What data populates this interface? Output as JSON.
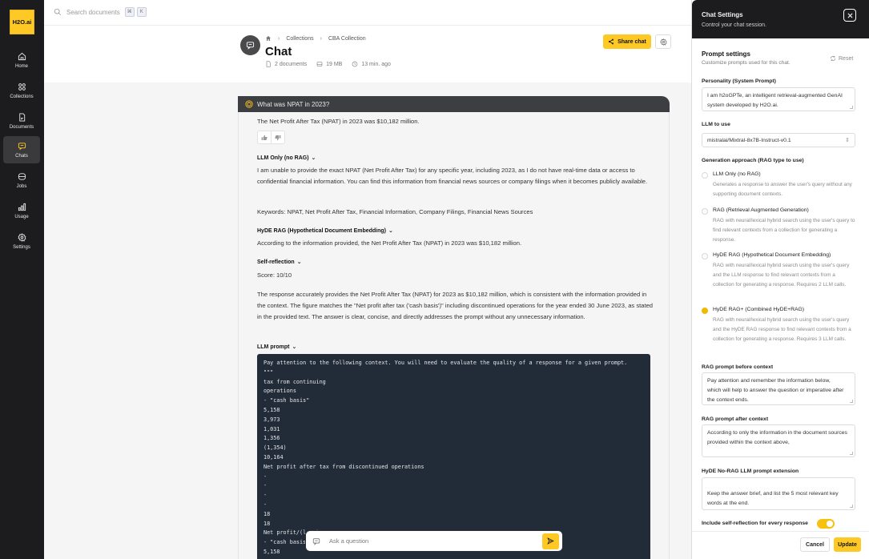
{
  "app": {
    "logo": "H2O.ai"
  },
  "sidebar": {
    "items": [
      {
        "label": "Home",
        "icon": "home-icon"
      },
      {
        "label": "Collections",
        "icon": "collections-icon"
      },
      {
        "label": "Documents",
        "icon": "document-icon"
      },
      {
        "label": "Chats",
        "icon": "chat-icon",
        "active": true
      },
      {
        "label": "Jobs",
        "icon": "jobs-icon"
      },
      {
        "label": "Usage",
        "icon": "usage-icon"
      },
      {
        "label": "Settings",
        "icon": "settings-icon"
      }
    ]
  },
  "search": {
    "placeholder": "Search documents",
    "kbd": [
      "⌘",
      "K"
    ]
  },
  "header": {
    "breadcrumb": [
      "Collections",
      "CBA Collection"
    ],
    "title": "Chat",
    "meta": {
      "documents": "2 documents",
      "size": "19 MB",
      "time": "13 min. ago"
    },
    "share_label": "Share chat"
  },
  "conversation": {
    "question": "What was NPAT in 2023?",
    "answer": "The Net Profit After Tax (NPAT) in 2023 was $10,182 million.",
    "sections": {
      "llm_only": {
        "title": "LLM Only (no RAG)",
        "text": "I am unable to provide the exact NPAT (Net Profit After Tax) for any specific year, including 2023, as I do not have real-time data or access to confidential financial information. You can find this information from financial news sources or company filings when it becomes publicly available.",
        "keywords": "Keywords: NPAT, Net Profit After Tax, Financial Information, Company Filings, Financial News Sources"
      },
      "hyde": {
        "title": "HyDE RAG (Hypothetical Document Embedding)",
        "text": "According to the information provided, the Net Profit After Tax (NPAT) in 2023 was $10,182 million."
      },
      "self_reflection": {
        "title": "Self-reflection",
        "score": "Score: 10/10",
        "text": "The response accurately provides the Net Profit After Tax (NPAT) for 2023 as $10,182 million, which is consistent with the information provided in the context. The figure matches the \"Net profit after tax ('cash basis')\" including discontinued operations for the year ended 30 June 2023, as stated in the provided text. The answer is clear, concise, and directly addresses the prompt without any unnecessary information."
      },
      "llm_prompt": {
        "title": "LLM prompt",
        "lines": [
          "Pay attention to the following context. You will need to evaluate the quality of a response for a given prompt.",
          "\"\"\"",
          "tax from continuing",
          "operations",
          "- \"cash basis\"",
          "5,158",
          "3,973",
          "1,031",
          "1,356",
          "(1,354)",
          "10,164",
          "Net profit after tax from discontinued operations",
          "-",
          "-",
          "-",
          "-",
          "18",
          "18",
          "Net profit/(loss)",
          "- \"cash basis\"",
          "5,158"
        ]
      }
    },
    "ask_placeholder": "Ask a question"
  },
  "settings_panel": {
    "title": "Chat Settings",
    "subtitle": "Control your chat session.",
    "prompt_settings": {
      "title": "Prompt settings",
      "subtitle": "Customize prompts used for this chat.",
      "reset_label": "Reset"
    },
    "personality": {
      "label": "Personality (System Prompt)",
      "value": "I am h2oGPTe, an intelligent retrieval-augmented GenAI system developed by H2O.ai."
    },
    "llm": {
      "label": "LLM to use",
      "value": "mistralai/Mixtral-8x7B-Instruct-v0.1"
    },
    "generation": {
      "label": "Generation approach (RAG type to use)",
      "options": [
        {
          "title": "LLM Only (no RAG)",
          "desc": "Generates a response to answer the user's query without any supporting document contexts.",
          "selected": false
        },
        {
          "title": "RAG (Retrieval Augmented Generation)",
          "desc": "RAG with neural/lexical hybrid search using the user's query to find relevant contexts from a collection for generating a response.",
          "selected": false
        },
        {
          "title": "HyDE RAG (Hypothetical Document Embedding)",
          "desc": "RAG with neural/lexical hybrid search using the user's query and the LLM response to find relevant contexts from a collection for generating a response. Requires 2 LLM calls.",
          "selected": false
        },
        {
          "title": "HyDE RAG+ (Combined HyDE+RAG)",
          "desc": "RAG with neural/lexical hybrid search using the user's query and the HyDE RAG response to find relevant contexts from a collection for generating a response. Requires 3 LLM calls.",
          "selected": true
        }
      ]
    },
    "rag_before": {
      "label": "RAG prompt before context",
      "value": "Pay attention and remember the information below, which will help to answer the question or imperative after the context ends."
    },
    "rag_after": {
      "label": "RAG prompt after context",
      "value": "According to only the information in the document sources provided within the context above,"
    },
    "hyde_ext": {
      "label": "HyDE No-RAG LLM prompt extension",
      "value": "Keep the answer brief, and list the 5 most relevant key words at the end."
    },
    "self_reflection_toggle": {
      "label": "Include self-reflection for every response",
      "on": true
    },
    "cancel_label": "Cancel",
    "update_label": "Update",
    "accent": "#fec925"
  }
}
